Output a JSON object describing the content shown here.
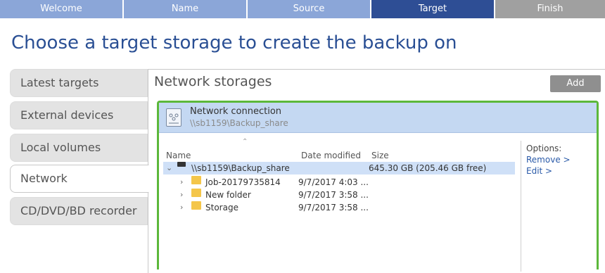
{
  "steps": [
    "Welcome",
    "Name",
    "Source",
    "Target",
    "Finish"
  ],
  "page_title": "Choose a target storage to create the backup on",
  "categories": [
    "Latest targets",
    "External devices",
    "Local volumes",
    "Network",
    "CD/DVD/BD recorder"
  ],
  "panel": {
    "title": "Network storages",
    "add_label": "Add",
    "connection": {
      "name": "Network connection",
      "path": "\\\\sb1159\\Backup_share"
    },
    "columns": {
      "name": "Name",
      "date": "Date modified",
      "size": "Size"
    },
    "tree": [
      {
        "name": "\\\\sb1159\\Backup_share",
        "date": "",
        "size": "645.30 GB (205.46 GB free)"
      },
      {
        "name": "Job-20179735814",
        "date": "9/7/2017 4:03 ...",
        "size": ""
      },
      {
        "name": "New folder",
        "date": "9/7/2017 3:58 ...",
        "size": ""
      },
      {
        "name": "Storage",
        "date": "9/7/2017 3:58 ...",
        "size": ""
      }
    ],
    "options": {
      "label": "Options:",
      "remove": "Remove >",
      "edit": "Edit >"
    }
  },
  "colors": {
    "active_step": "#2e4e95",
    "done_step": "#8ba6d8",
    "future_step": "#a0a0a0",
    "title": "#2a4f94",
    "selection_border": "#5cb83a",
    "connection_bg": "#c4d8f2",
    "link": "#2a5aa8"
  }
}
